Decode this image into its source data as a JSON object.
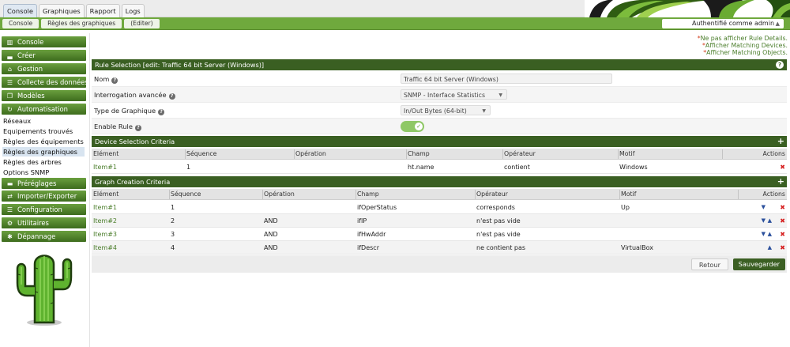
{
  "top_tabs": [
    "Console",
    "Graphiques",
    "Rapport",
    "Logs"
  ],
  "breadcrumbs": [
    "Console",
    "Règles des graphiques",
    "(Editer)"
  ],
  "user_label": "Authentifié comme admin",
  "sidebar": {
    "sections_top": [
      {
        "label": "Console",
        "icon": "map-icon"
      },
      {
        "label": "Créer",
        "icon": "chart-icon"
      },
      {
        "label": "Gestion",
        "icon": "home-icon"
      },
      {
        "label": "Collecte des données",
        "icon": "list-icon"
      },
      {
        "label": "Modèles",
        "icon": "copy-icon"
      },
      {
        "label": "Automatisation",
        "icon": "refresh-icon"
      }
    ],
    "sub_items": [
      "Réseaux",
      "Equipements trouvés",
      "Règles des équipements",
      "Règles des graphiques",
      "Règles des arbres",
      "Options SNMP"
    ],
    "sections_bottom": [
      {
        "label": "Préréglages",
        "icon": "folder-icon"
      },
      {
        "label": "Importer/Exporter",
        "icon": "exchange-icon"
      },
      {
        "label": "Configuration",
        "icon": "sliders-icon"
      },
      {
        "label": "Utilitaires",
        "icon": "gears-icon"
      },
      {
        "label": "Dépannage",
        "icon": "bug-icon"
      }
    ]
  },
  "links": [
    "Ne pas afficher Rule Details.",
    "Afficher Matching Devices.",
    "Afficher Matching Objects."
  ],
  "rule_selection": {
    "header": "Rule Selection [edit: Traffic 64 bit Server (Windows)]",
    "fields": [
      {
        "label": "Nom",
        "value": "Traffic 64 bit Server (Windows)"
      },
      {
        "label": "Interrogation avancée",
        "value": "SNMP - Interface Statistics"
      },
      {
        "label": "Type de Graphique",
        "value": "In/Out Bytes (64-bit)"
      },
      {
        "label": "Enable Rule",
        "value": ""
      }
    ]
  },
  "device_criteria": {
    "header": "Device Selection Criteria",
    "columns": [
      "Elément",
      "Séquence",
      "Opération",
      "Champ",
      "Opérateur",
      "Motif",
      "Actions"
    ],
    "rows": [
      [
        "Item#1",
        "1",
        "",
        "ht.name",
        "contient",
        "Windows"
      ]
    ]
  },
  "graph_criteria": {
    "header": "Graph Creation Criteria",
    "columns": [
      "Elément",
      "Séquence",
      "Opération",
      "Champ",
      "Opérateur",
      "Motif",
      "Actions"
    ],
    "rows": [
      [
        "Item#1",
        "1",
        "",
        "ifOperStatus",
        "corresponds",
        "Up"
      ],
      [
        "Item#2",
        "2",
        "AND",
        "ifIP",
        "n'est pas vide",
        ""
      ],
      [
        "Item#3",
        "3",
        "AND",
        "ifHwAddr",
        "n'est pas vide",
        ""
      ],
      [
        "Item#4",
        "4",
        "AND",
        "ifDescr",
        "ne contient pas",
        "VirtualBox"
      ]
    ]
  },
  "buttons": {
    "back": "Retour",
    "save": "Sauvegarder"
  },
  "colors": {
    "accent": "#3a5f22",
    "nav": "#5a8d2f",
    "breadcrumb": "#6fa93d",
    "delete": "#d61f1f",
    "link": "#4a7d2a"
  }
}
